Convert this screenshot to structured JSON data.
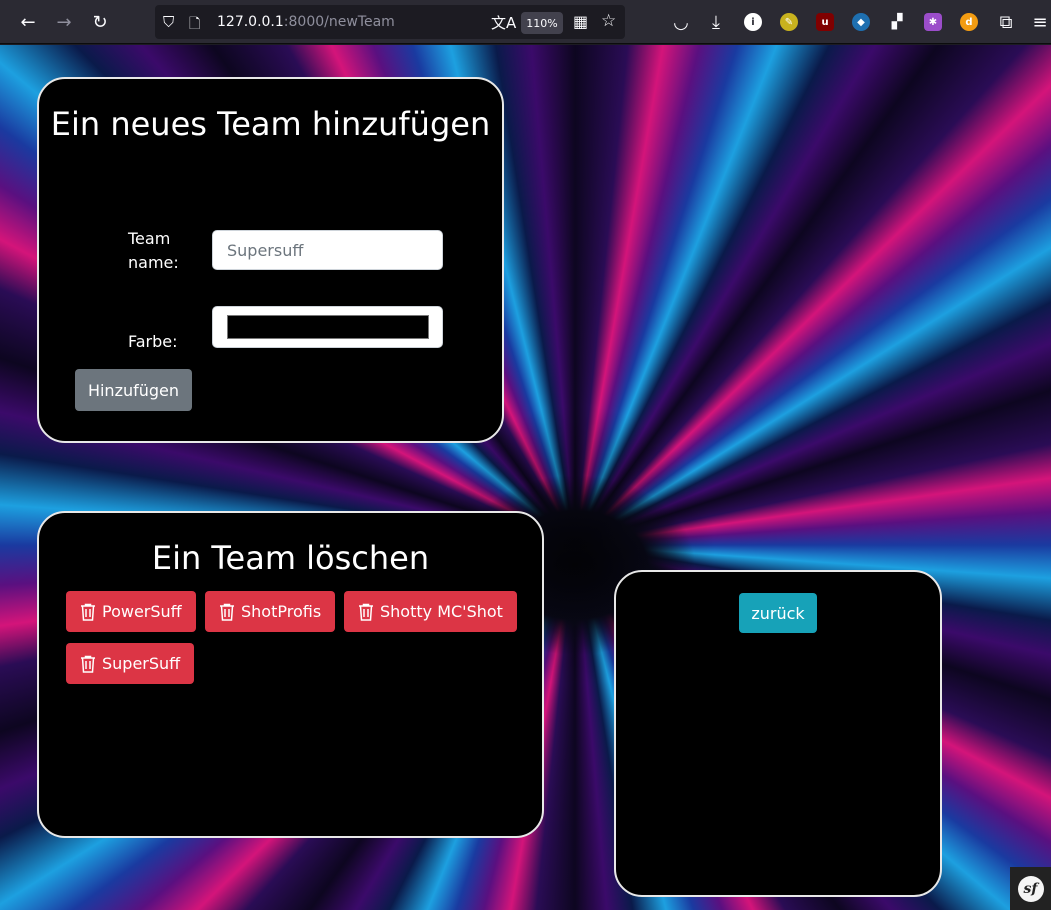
{
  "browser": {
    "url_host": "127.0.0.1",
    "url_rest": ":8000/newTeam",
    "zoom": "110%",
    "icons": [
      "back-icon",
      "forward-icon",
      "reload-icon",
      "shield-icon",
      "page-icon",
      "translate-icon",
      "grid-icon",
      "star-icon",
      "pocket-icon",
      "download-icon",
      "info-icon",
      "extensions-icon",
      "menu-icon"
    ]
  },
  "add_team": {
    "title": "Ein neues Team hinzufügen",
    "name_label": "Team name:",
    "name_placeholder": "Supersuff",
    "color_label": "Farbe:",
    "color_value": "#000000",
    "submit_label": "Hinzufügen"
  },
  "delete_team": {
    "title": "Ein Team löschen",
    "teams": [
      "PowerSuff",
      "ShotProfis",
      "Shotty MC'Shot",
      "SuperSuff"
    ]
  },
  "back": {
    "label": "zurück"
  },
  "colors": {
    "danger": "#dc3545",
    "secondary": "#6c757d",
    "info": "#17a2b8"
  }
}
